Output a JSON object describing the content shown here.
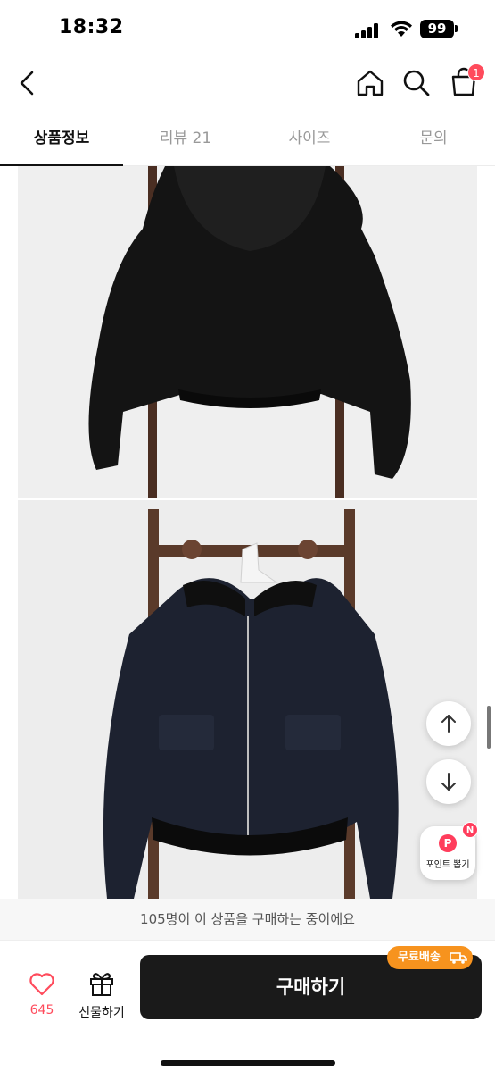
{
  "status_bar": {
    "time": "18:32",
    "battery": "99",
    "icons": [
      "signal-icon",
      "wifi-icon",
      "battery-icon"
    ]
  },
  "header": {
    "icons": [
      "back-arrow-icon",
      "home-icon",
      "search-icon",
      "shopping-bag-icon"
    ],
    "cart_count": "1"
  },
  "tabs": [
    {
      "label": "상품정보",
      "active": true
    },
    {
      "label": "리뷰 21",
      "active": false
    },
    {
      "label": "사이즈",
      "active": false
    },
    {
      "label": "문의",
      "active": false
    }
  ],
  "floating": {
    "up_icon": "arrow-up-icon",
    "down_icon": "arrow-down-icon",
    "point_badge_letter": "P",
    "point_label": "포인트 뽑기",
    "new_badge": "N"
  },
  "notice": {
    "text": "105명이 이 상품을 구매하는 중이에요"
  },
  "bottom_bar": {
    "like_count": "645",
    "gift_label": "선물하기",
    "buy_label": "구매하기",
    "shipping_badge": "무료배송",
    "colors": {
      "accent_red": "#ff4b5c",
      "buy_button": "#1a1a1a",
      "shipping_orange": "#f7931e"
    }
  }
}
